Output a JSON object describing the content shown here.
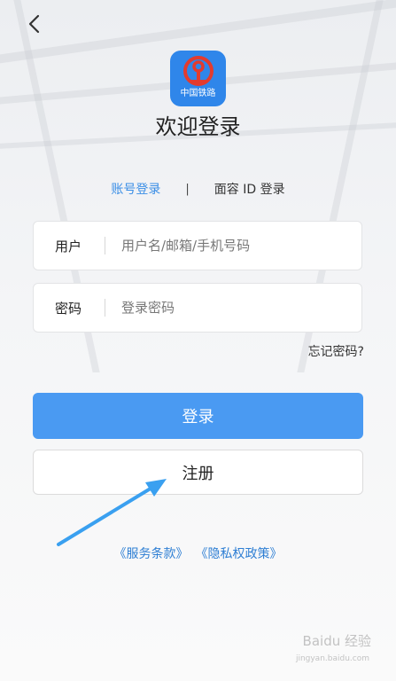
{
  "header": {
    "back_icon": "chevron-left-icon"
  },
  "logo": {
    "text": "中国铁路",
    "color": "#2f86ea",
    "icon": "railway-emblem-icon"
  },
  "title": "欢迎登录",
  "tabs": {
    "active": "账号登录",
    "separator": "|",
    "other": "面容 ID 登录"
  },
  "form": {
    "user_label": "用户",
    "user_placeholder": "用户名/邮箱/手机号码",
    "password_label": "密码",
    "password_placeholder": "登录密码",
    "forgot": "忘记密码?"
  },
  "buttons": {
    "login": "登录",
    "register": "注册"
  },
  "links": {
    "terms": "《服务条款》",
    "privacy": "《隐私权政策》"
  },
  "colors": {
    "primary": "#4a9af2",
    "link": "#2f7fd4",
    "annotation_arrow": "#3aa0f0"
  },
  "watermark": {
    "text": "Baidu 经验",
    "url": "jingyan.baidu.com"
  }
}
